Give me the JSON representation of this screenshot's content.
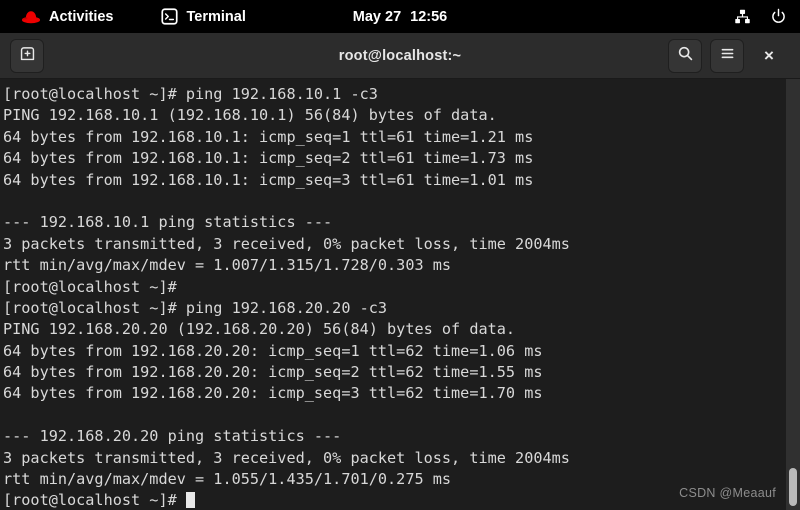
{
  "topbar": {
    "activities_label": "Activities",
    "app_label": "Terminal",
    "date": "May 27",
    "time": "12:56",
    "icons": {
      "logo": "redhat-logo-icon",
      "app": "terminal-icon",
      "network": "network-wired-icon",
      "power": "power-icon"
    }
  },
  "window": {
    "title": "root@localhost:~",
    "buttons": {
      "new_tab": "new-tab-icon",
      "search": "search-icon",
      "menu": "hamburger-menu-icon",
      "close": "×"
    }
  },
  "terminal": {
    "lines": [
      "[root@localhost ~]# ping 192.168.10.1 -c3",
      "PING 192.168.10.1 (192.168.10.1) 56(84) bytes of data.",
      "64 bytes from 192.168.10.1: icmp_seq=1 ttl=61 time=1.21 ms",
      "64 bytes from 192.168.10.1: icmp_seq=2 ttl=61 time=1.73 ms",
      "64 bytes from 192.168.10.1: icmp_seq=3 ttl=61 time=1.01 ms",
      "",
      "--- 192.168.10.1 ping statistics ---",
      "3 packets transmitted, 3 received, 0% packet loss, time 2004ms",
      "rtt min/avg/max/mdev = 1.007/1.315/1.728/0.303 ms",
      "[root@localhost ~]# ",
      "[root@localhost ~]# ping 192.168.20.20 -c3",
      "PING 192.168.20.20 (192.168.20.20) 56(84) bytes of data.",
      "64 bytes from 192.168.20.20: icmp_seq=1 ttl=62 time=1.06 ms",
      "64 bytes from 192.168.20.20: icmp_seq=2 ttl=62 time=1.55 ms",
      "64 bytes from 192.168.20.20: icmp_seq=3 ttl=62 time=1.70 ms",
      "",
      "--- 192.168.20.20 ping statistics ---",
      "3 packets transmitted, 3 received, 0% packet loss, time 2004ms",
      "rtt min/avg/max/mdev = 1.055/1.435/1.701/0.275 ms"
    ],
    "prompt_last": "[root@localhost ~]# "
  },
  "watermark": "CSDN @Meaauf",
  "colors": {
    "topbar_bg": "#000000",
    "titlebar_bg": "#2c2c2c",
    "terminal_bg": "#1d1d1d",
    "text": "#d8d8d8",
    "redhat_red": "#ee0000",
    "cursor": "#e9e9e9"
  }
}
